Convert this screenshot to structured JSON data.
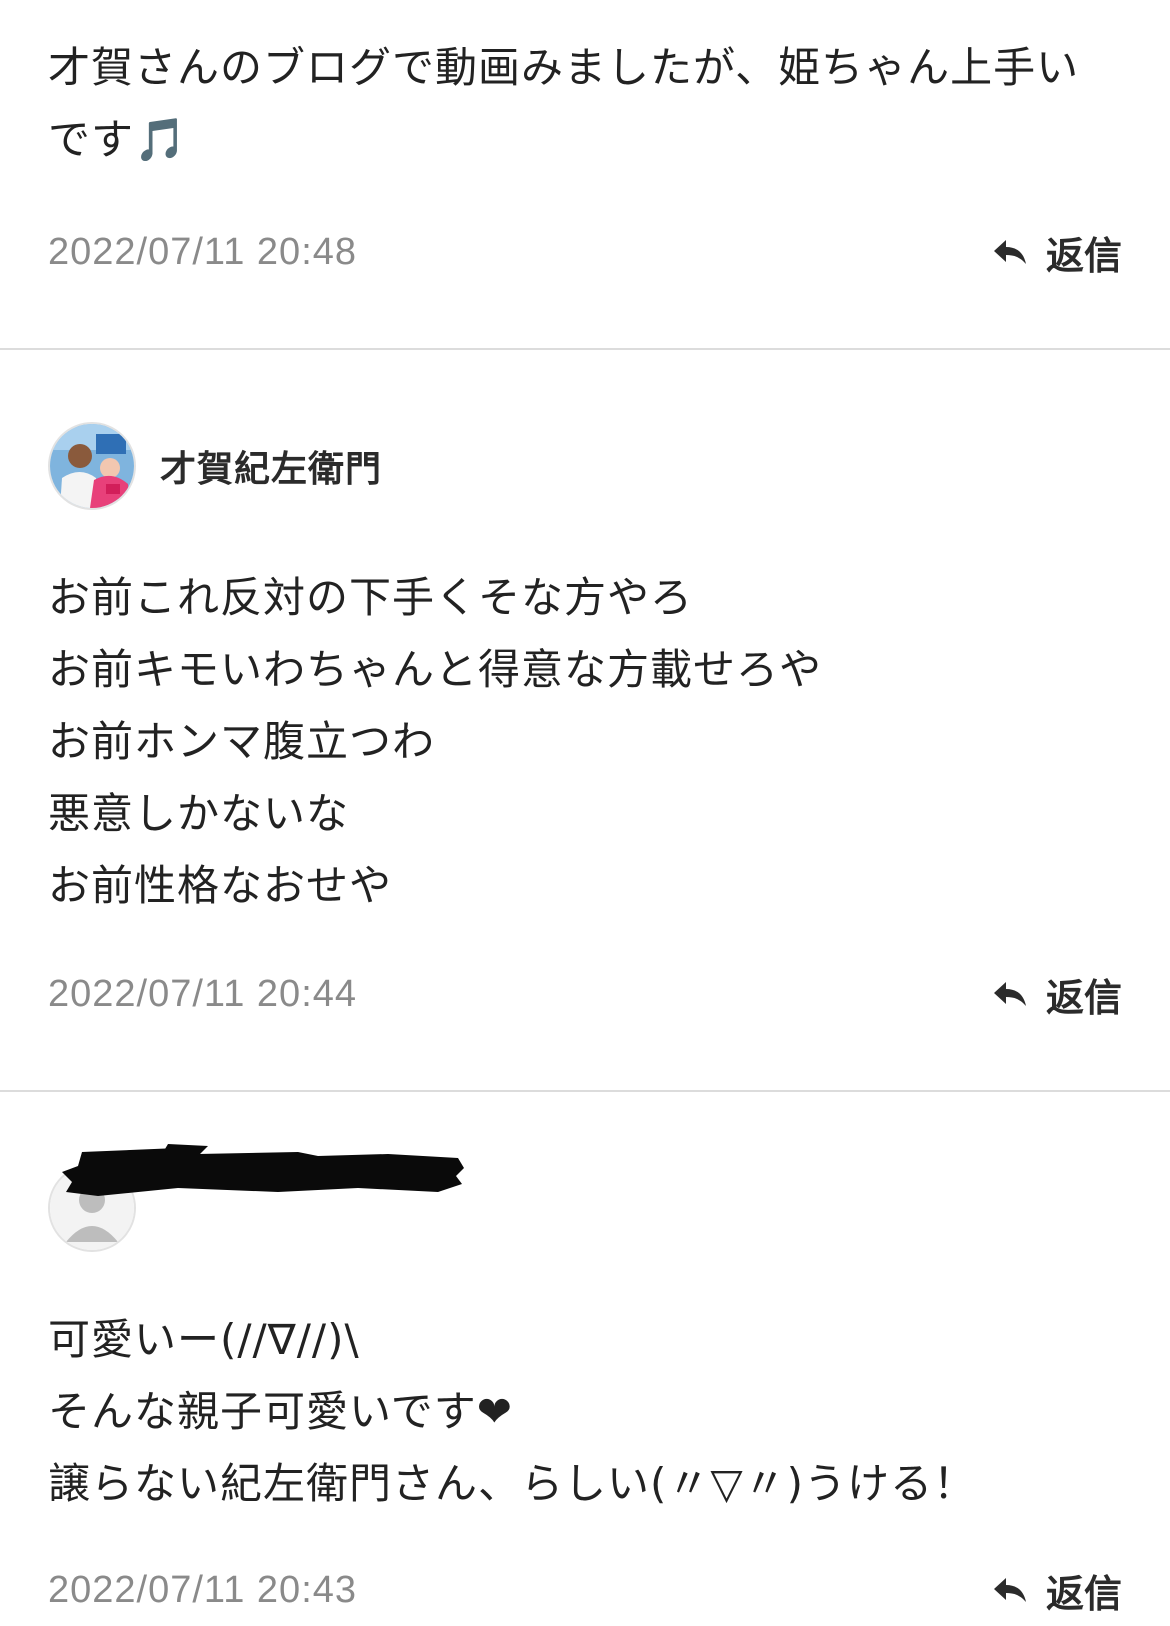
{
  "comments": [
    {
      "body_lines": [
        "才賀さんのブログで動画みましたが、姫ちゃん上手いです🎵"
      ],
      "timestamp": "2022/07/11 20:48",
      "reply_label": "返信"
    },
    {
      "author": {
        "name": "才賀紀左衛門",
        "avatar_icon": "profile-photo-avatar"
      },
      "body_lines": [
        "お前これ反対の下手くそな方やろ",
        "お前キモいわちゃんと得意な方載せろや",
        "お前ホンマ腹立つわ",
        "悪意しかないな",
        "お前性格なおせや"
      ],
      "timestamp": "2022/07/11 20:44",
      "reply_label": "返信"
    },
    {
      "author": {
        "name_redacted": true,
        "avatar_icon": "default-user-avatar"
      },
      "body_lines": [
        "可愛いー(//∇//)\\",
        "そんな親子可愛いです❤",
        "譲らない紀左衛門さん、らしい(〃▽〃)うける！"
      ],
      "timestamp": "2022/07/11 20:43",
      "reply_label": "返信"
    }
  ],
  "colors": {
    "text": "#222222",
    "timestamp": "#8a8a8a",
    "divider": "#dcdcdc",
    "background": "#ffffff"
  }
}
